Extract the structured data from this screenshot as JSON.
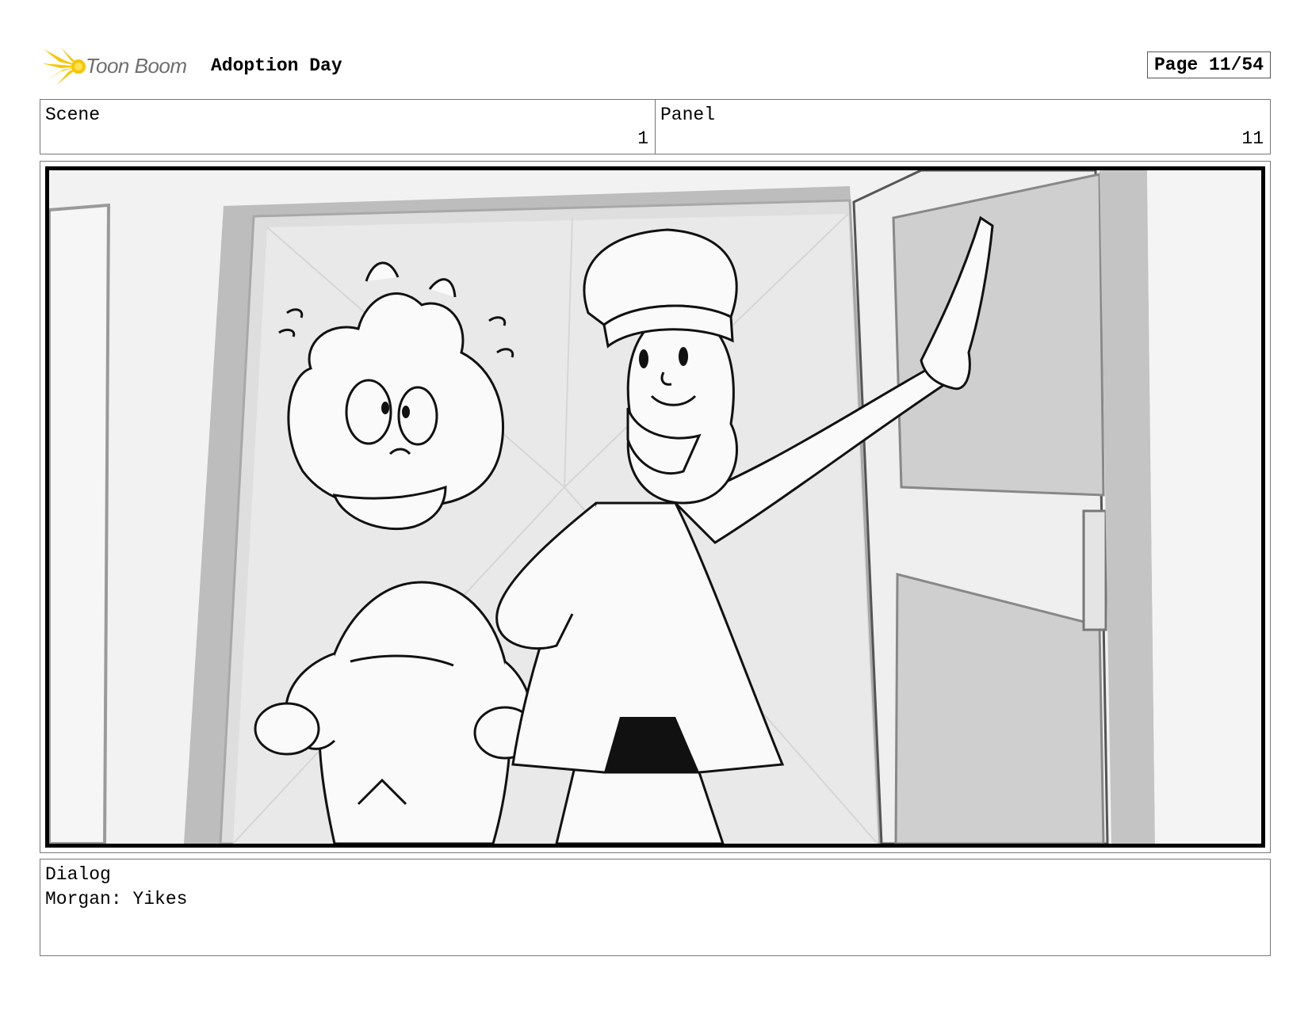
{
  "header": {
    "logo_text": "Toon Boom",
    "project_title": "Adoption Day",
    "page_label": "Page 11/54"
  },
  "info": {
    "scene_label": "Scene",
    "scene_value": "1",
    "panel_label": "Panel",
    "panel_value": "11"
  },
  "dialog": {
    "label": "Dialog",
    "text": "Morgan: Yikes"
  },
  "colors": {
    "logo_accent": "#f7c600",
    "frame_border": "#000000",
    "wall": "#ededed"
  },
  "icons": {
    "logo": "toon-boom-star-logo"
  }
}
